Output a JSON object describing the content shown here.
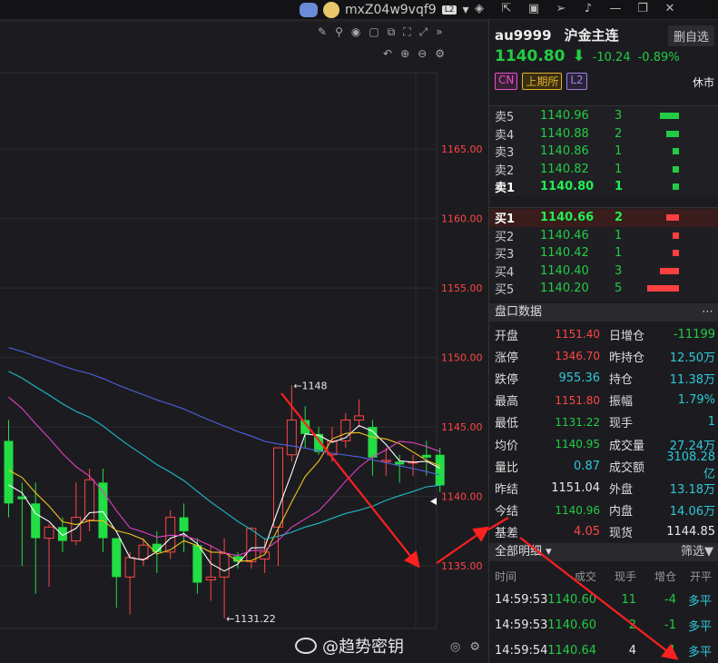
{
  "titlebar": {
    "username": "mxZ04w9vqf9",
    "level_badge": "L2",
    "icons": [
      "layers-icon",
      "export-icon",
      "video-icon",
      "send-icon",
      "bell-icon",
      "minimize-icon",
      "restore-icon",
      "close-icon"
    ]
  },
  "chart_toolbar": {
    "top_icons": [
      "pen-icon",
      "pin-icon",
      "eye-icon",
      "camera-icon",
      "copy-icon",
      "fullscreen-icon",
      "expand-icon",
      "collapse-right-icon"
    ],
    "second_icons": [
      "undo-icon",
      "zoom-in-icon",
      "zoom-out-icon",
      "settings-icon"
    ]
  },
  "chart_data": {
    "type": "candlestick",
    "y_ticks": [
      "1165.00",
      "1160.00",
      "1155.00",
      "1150.00",
      "1145.00",
      "1140.00",
      "1135.00"
    ],
    "ylim": [
      1130.5,
      1170.5
    ],
    "high_label": "1148",
    "low_label": "1131.22",
    "candles": [
      {
        "o": 1144.0,
        "h": 1145.5,
        "l": 1138.5,
        "c": 1139.5
      },
      {
        "o": 1140.0,
        "h": 1141.0,
        "l": 1135.0,
        "c": 1139.8
      },
      {
        "o": 1139.5,
        "h": 1141.0,
        "l": 1133.0,
        "c": 1137.0
      },
      {
        "o": 1137.0,
        "h": 1138.0,
        "l": 1133.5,
        "c": 1137.8
      },
      {
        "o": 1137.8,
        "h": 1138.5,
        "l": 1136.0,
        "c": 1136.8
      },
      {
        "o": 1136.8,
        "h": 1141.0,
        "l": 1136.5,
        "c": 1138.5
      },
      {
        "o": 1138.3,
        "h": 1142.0,
        "l": 1137.5,
        "c": 1141.2
      },
      {
        "o": 1141.0,
        "h": 1142.0,
        "l": 1136.0,
        "c": 1137.0
      },
      {
        "o": 1137.0,
        "h": 1137.0,
        "l": 1132.0,
        "c": 1134.2
      },
      {
        "o": 1134.2,
        "h": 1136.0,
        "l": 1131.5,
        "c": 1135.6
      },
      {
        "o": 1135.5,
        "h": 1137.0,
        "l": 1135.0,
        "c": 1136.5
      },
      {
        "o": 1136.6,
        "h": 1137.5,
        "l": 1134.5,
        "c": 1136.0
      },
      {
        "o": 1136.0,
        "h": 1139.0,
        "l": 1135.5,
        "c": 1138.5
      },
      {
        "o": 1138.5,
        "h": 1139.5,
        "l": 1136.0,
        "c": 1137.5
      },
      {
        "o": 1136.5,
        "h": 1137.0,
        "l": 1133.0,
        "c": 1133.8
      },
      {
        "o": 1134.0,
        "h": 1136.5,
        "l": 1132.5,
        "c": 1134.2
      },
      {
        "o": 1134.2,
        "h": 1137.0,
        "l": 1131.22,
        "c": 1135.9
      },
      {
        "o": 1135.7,
        "h": 1136.0,
        "l": 1134.8,
        "c": 1135.3
      },
      {
        "o": 1135.3,
        "h": 1137.8,
        "l": 1134.8,
        "c": 1137.7
      },
      {
        "o": 1135.5,
        "h": 1137.0,
        "l": 1134.5,
        "c": 1136.0
      },
      {
        "o": 1137.8,
        "h": 1143.5,
        "l": 1135.0,
        "c": 1143.5
      },
      {
        "o": 1143.0,
        "h": 1148.0,
        "l": 1142.5,
        "c": 1145.5
      },
      {
        "o": 1145.5,
        "h": 1146.5,
        "l": 1143.5,
        "c": 1144.5
      },
      {
        "o": 1144.5,
        "h": 1145.0,
        "l": 1143.0,
        "c": 1143.2
      },
      {
        "o": 1143.0,
        "h": 1145.0,
        "l": 1142.5,
        "c": 1144.0
      },
      {
        "o": 1144.0,
        "h": 1146.0,
        "l": 1143.5,
        "c": 1145.5
      },
      {
        "o": 1145.5,
        "h": 1147.0,
        "l": 1145.0,
        "c": 1145.8
      },
      {
        "o": 1145.0,
        "h": 1145.5,
        "l": 1141.5,
        "c": 1142.8
      },
      {
        "o": 1142.5,
        "h": 1143.5,
        "l": 1141.5,
        "c": 1142.6
      },
      {
        "o": 1142.5,
        "h": 1143.0,
        "l": 1141.0,
        "c": 1142.3
      },
      {
        "o": 1142.4,
        "h": 1143.0,
        "l": 1141.5,
        "c": 1142.5
      },
      {
        "o": 1143.0,
        "h": 1144.0,
        "l": 1141.5,
        "c": 1142.8
      },
      {
        "o": 1143.0,
        "h": 1143.5,
        "l": 1140.3,
        "c": 1140.8
      }
    ]
  },
  "quote": {
    "symbol": "au9999",
    "name": "沪金主连",
    "watch_btn": "删自选",
    "price": "1140.80",
    "change": "-10.24",
    "change_pct": "-0.89%",
    "tags": [
      "CN",
      "上期所",
      "L2"
    ],
    "status": "休市"
  },
  "asks": [
    {
      "label": "卖5",
      "price": "1140.96",
      "vol": "3",
      "bar": 3
    },
    {
      "label": "卖4",
      "price": "1140.88",
      "vol": "2",
      "bar": 2
    },
    {
      "label": "卖3",
      "price": "1140.86",
      "vol": "1",
      "bar": 1
    },
    {
      "label": "卖2",
      "price": "1140.82",
      "vol": "1",
      "bar": 1
    },
    {
      "label": "卖1",
      "price": "1140.80",
      "vol": "1",
      "bar": 1
    }
  ],
  "bids": [
    {
      "label": "买1",
      "price": "1140.66",
      "vol": "2",
      "bar": 2
    },
    {
      "label": "买2",
      "price": "1140.46",
      "vol": "1",
      "bar": 1
    },
    {
      "label": "买3",
      "price": "1140.42",
      "vol": "1",
      "bar": 1
    },
    {
      "label": "买4",
      "price": "1140.40",
      "vol": "3",
      "bar": 3
    },
    {
      "label": "买5",
      "price": "1140.20",
      "vol": "5",
      "bar": 5
    }
  ],
  "stats_header": "盘口数据",
  "stats": [
    {
      "k1": "开盘",
      "v1": "1151.40",
      "c1": "red",
      "k2": "日增仓",
      "v2": "-11199",
      "c2": "grn"
    },
    {
      "k1": "涨停",
      "v1": "1346.70",
      "c1": "red",
      "k2": "昨持仓",
      "v2": "12.50万",
      "c2": "cyan"
    },
    {
      "k1": "跌停",
      "v1": "955.36",
      "c1": "cyan",
      "k2": "持仓",
      "v2": "11.38万",
      "c2": "cyan"
    },
    {
      "k1": "最高",
      "v1": "1151.80",
      "c1": "red",
      "k2": "振幅",
      "v2": "1.79%",
      "c2": "cyan"
    },
    {
      "k1": "最低",
      "v1": "1131.22",
      "c1": "grn",
      "k2": "现手",
      "v2": "1",
      "c2": "cyan"
    },
    {
      "k1": "均价",
      "v1": "1140.95",
      "c1": "grn",
      "k2": "成交量",
      "v2": "27.24万",
      "c2": "cyan"
    },
    {
      "k1": "量比",
      "v1": "0.87",
      "c1": "cyan",
      "k2": "成交额",
      "v2": "3108.28亿",
      "c2": "cyan"
    },
    {
      "k1": "昨结",
      "v1": "1151.04",
      "c1": "wht",
      "k2": "外盘",
      "v2": "13.18万",
      "c2": "cyan"
    },
    {
      "k1": "今结",
      "v1": "1140.96",
      "c1": "grn",
      "k2": "内盘",
      "v2": "14.06万",
      "c2": "cyan"
    },
    {
      "k1": "基差",
      "v1": "4.05",
      "c1": "red",
      "k2": "现货",
      "v2": "1144.85",
      "c2": "wht"
    }
  ],
  "trades_header": "全部明细",
  "filter_label": "筛选",
  "trade_cols": [
    "时间",
    "成交",
    "现手",
    "增仓",
    "开平"
  ],
  "trades": [
    {
      "time": "14:59:53",
      "price": "1140.60",
      "vol": "11",
      "oi": "-4",
      "type": "多平"
    },
    {
      "time": "14:59:53",
      "price": "1140.60",
      "vol": "2",
      "oi": "-1",
      "type": "多平"
    },
    {
      "time": "14:59:54",
      "price": "1140.64",
      "vol": "4",
      "oi": "-1",
      "type": "多平"
    }
  ],
  "watermark": "@趋势密钥"
}
